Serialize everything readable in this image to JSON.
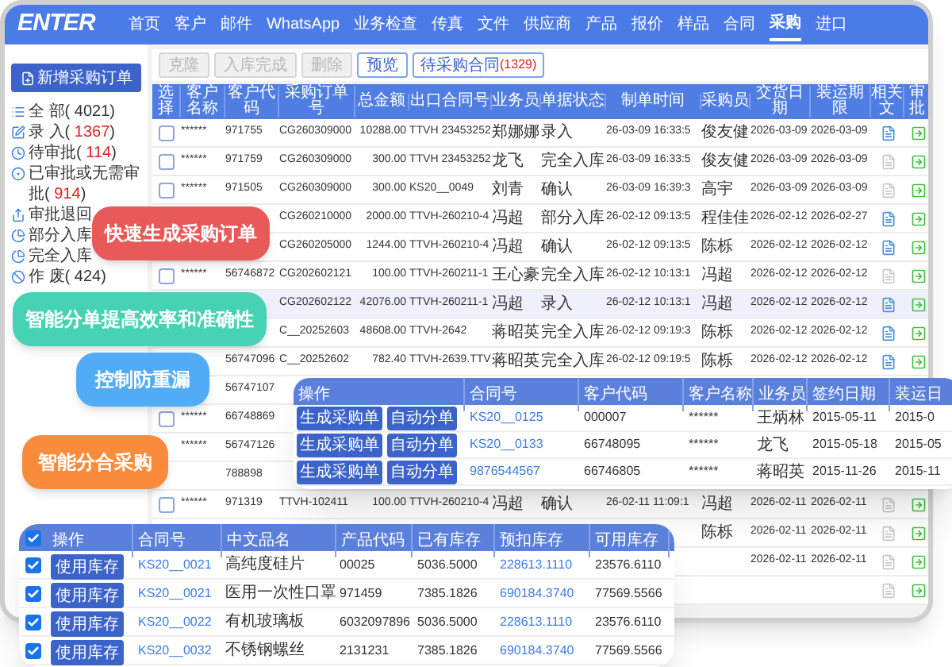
{
  "nav": {
    "logo": "ENTER",
    "items": [
      {
        "label": "首页",
        "selected": false
      },
      {
        "label": "客户",
        "selected": false
      },
      {
        "label": "邮件",
        "selected": false
      },
      {
        "label": "WhatsApp",
        "selected": false
      },
      {
        "label": "业务检查",
        "selected": false
      },
      {
        "label": "传真",
        "selected": false
      },
      {
        "label": "文件",
        "selected": false
      },
      {
        "label": "供应商",
        "selected": false
      },
      {
        "label": "产品",
        "selected": false
      },
      {
        "label": "报价",
        "selected": false
      },
      {
        "label": "样品",
        "selected": false
      },
      {
        "label": "合同",
        "selected": false
      },
      {
        "label": "采购",
        "selected": true
      },
      {
        "label": "进口",
        "selected": false
      }
    ]
  },
  "sidebar": {
    "new_button": "新增采购订单",
    "items": [
      {
        "label": "全 部(",
        "count": " 4021",
        "suffix": ")",
        "alert": false
      },
      {
        "label": "录 入(",
        "count": " 1367",
        "suffix": ")",
        "alert": true
      },
      {
        "label": "待审批(",
        "count": " 114",
        "suffix": ")",
        "alert": true
      },
      {
        "label": "已审批或无需审批(",
        "count": " 914",
        "suffix": ")",
        "alert": true
      },
      {
        "label": "审批退回"
      },
      {
        "label": "部分入库"
      },
      {
        "label": "完全入库"
      },
      {
        "label": "作 废(",
        "count": " 424",
        "suffix": ")",
        "alert": false
      }
    ]
  },
  "toolbar": {
    "buttons": [
      {
        "label": "克隆",
        "disabled": true
      },
      {
        "label": "入库完成",
        "disabled": true
      },
      {
        "label": "删除",
        "disabled": true
      },
      {
        "label": "预览",
        "disabled": false
      }
    ],
    "pending": {
      "label": "待采购合同",
      "count": "(1329)"
    }
  },
  "table": {
    "columns": [
      "选择",
      "客户名称",
      "客户代码",
      "采购订单号",
      "总金额",
      "出口合同号",
      "业务员",
      "单据状态",
      "制单时间",
      "采购员",
      "交货日期",
      "装运期限",
      "相关文",
      "审批"
    ],
    "rows": [
      {
        "selected": false,
        "checked": false,
        "name": "******",
        "code": "971755",
        "order": "CG260309000",
        "amount": "10288.00",
        "contract": "TTVH 23453252",
        "sales": "郑娜娜",
        "status": "录入",
        "created": "26-03-09 16:33:5",
        "buyer": "俊友健",
        "delivery": "2026-03-09",
        "shipment": "2026-03-09",
        "has_attachment": true,
        "approval_icon": true
      },
      {
        "selected": false,
        "checked": false,
        "name": "******",
        "code": "971759",
        "order": "CG260309000",
        "amount": "300.00",
        "contract": "TTVH 23453252",
        "sales": "龙飞",
        "status": "完全入库",
        "created": "26-03-09 16:33:5",
        "buyer": "俊友健",
        "delivery": "2026-03-09",
        "shipment": "2026-03-09",
        "has_attachment": false,
        "approval_icon": true
      },
      {
        "selected": false,
        "checked": false,
        "name": "******",
        "code": "971505",
        "order": "CG260309000",
        "amount": "300.00",
        "contract": "KS20__0049",
        "sales": "刘青",
        "status": "确认",
        "created": "26-03-09 16:39:3",
        "buyer": "高宇",
        "delivery": "2026-03-09",
        "shipment": "2026-03-09",
        "has_attachment": false,
        "approval_icon": true
      },
      {
        "selected": false,
        "order": "CG260210000",
        "amount": "2000.00",
        "contract": "TTVH-260210-4",
        "sales": "冯超",
        "status": "部分入库",
        "created": "26-02-12 09:13:5",
        "buyer": "程佳佳",
        "delivery": "2026-02-12",
        "shipment": "2026-02-27",
        "has_attachment": true,
        "approval_icon": true
      },
      {
        "selected": false,
        "order": "CG260205000",
        "amount": "1244.00",
        "contract": "TTVH-260210-4",
        "sales": "冯超",
        "status": "确认",
        "created": "26-02-12 09:13:5",
        "buyer": "陈栎",
        "delivery": "2026-02-12",
        "shipment": "2026-02-12",
        "has_attachment": true,
        "approval_icon": true
      },
      {
        "selected": false,
        "checked": false,
        "name": "******",
        "code": "56746872",
        "order": "CG202602121",
        "amount": "100.00",
        "contract": "TTVH-260211-1",
        "sales": "王心豪",
        "status": "完全入库",
        "created": "26-02-12 10:13:1",
        "buyer": "冯超",
        "delivery": "2026-02-12",
        "shipment": "2026-02-12",
        "has_attachment": false,
        "approval_icon": true
      },
      {
        "selected": true,
        "order": "CG202602122",
        "amount": "42076.00",
        "contract": "TTVH-260211-1",
        "sales": "冯超",
        "status": "录入",
        "created": "26-02-12 10:13:1",
        "buyer": "冯超",
        "delivery": "2026-02-12",
        "shipment": "2026-02-12",
        "has_attachment": true,
        "approval_icon": true
      },
      {
        "selected": false,
        "order": "C__20252603",
        "amount": "48608.00",
        "contract": "TTVH-2642",
        "sales": "蒋昭英",
        "status": "完全入库",
        "created": "26-02-12 09:19:3",
        "buyer": "陈栎",
        "delivery": "2026-02-12",
        "shipment": "2026-02-12",
        "has_attachment": true,
        "approval_icon": true
      },
      {
        "selected": false,
        "code": "56747096",
        "order": "C__20252602",
        "amount": "782.40",
        "contract": "TTVH-2639.TTV",
        "sales": "蒋昭英",
        "status": "完全入库",
        "created": "26-02-12 09:19:5",
        "buyer": "陈栎",
        "delivery": "2026-02-12",
        "shipment": "2026-02-12",
        "has_attachment": true,
        "approval_icon": true
      },
      {
        "selected": false,
        "code": "56747107"
      },
      {
        "selected": false,
        "checked": false,
        "name": "******",
        "code": "66748869"
      },
      {
        "selected": false,
        "name": "******",
        "code": "56747126"
      },
      {
        "selected": false,
        "code": "788898"
      },
      {
        "selected": false,
        "checked": false,
        "name": "******",
        "code": "971319",
        "order": "TTVH-102411",
        "amount": "100.00",
        "contract": "TTVH-260210-4",
        "sales": "冯超",
        "status": "确认",
        "created": "26-02-11 11:09:1",
        "buyer": "冯超",
        "delivery": "2026-02-11",
        "shipment": "2026-02-11",
        "has_attachment": false,
        "approval_icon": true
      },
      {
        "selected": false,
        "buyer": "陈栎",
        "delivery": "2026-02-11",
        "shipment": "2026-02-11",
        "has_attachment": false,
        "approval_icon": true
      },
      {
        "selected": false,
        "delivery": "2026-02-11",
        "shipment": "2026-02-11",
        "has_attachment": false,
        "approval_icon": true
      },
      {
        "selected": false,
        "has_attachment": false,
        "approval_icon": true
      }
    ]
  },
  "callouts": [
    {
      "text": "快速生成采购订单",
      "color": "#e85a5a"
    },
    {
      "text": "智能分单提高效率和准确性",
      "color": "#46d3b3"
    },
    {
      "text": "控制防重漏",
      "color": "#52acf5"
    },
    {
      "text": "智能分合采购",
      "color": "#f98c3c"
    }
  ],
  "contract_popup": {
    "columns": [
      "操作",
      "合同号",
      "客户代码",
      "客户名称",
      "业务员",
      "签约日期",
      "装运日"
    ],
    "rows": [
      {
        "buttons": [
          "生成采购单",
          "自动分单"
        ],
        "contract": "KS20__0125",
        "code": "000007",
        "name": "******",
        "sales": "王炳林",
        "signed": "2015-05-11",
        "shipment": "2015-0"
      },
      {
        "buttons": [
          "生成采购单",
          "自动分单"
        ],
        "contract": "KS20__0133",
        "code": "66748095",
        "name": "******",
        "sales": "龙飞",
        "signed": "2015-05-18",
        "shipment": "2015-05"
      },
      {
        "buttons": [
          "生成采购单",
          "自动分单"
        ],
        "contract": "9876544567",
        "code": "66746805",
        "name": "******",
        "sales": "蒋昭英",
        "signed": "2015-11-26",
        "shipment": "2015-11"
      }
    ]
  },
  "stock_popup": {
    "all_checked": true,
    "columns": [
      "操作",
      "合同号",
      "中文品名",
      "产品代码",
      "已有库存",
      "预扣库存",
      "可用库存"
    ],
    "rows": [
      {
        "checked": true,
        "button": "使用库存",
        "contract": "KS20__0021",
        "product": "高纯度硅片",
        "code": "00025",
        "stock": "5036.5000",
        "reserved": "228613.1110",
        "available": "23576.6110"
      },
      {
        "checked": true,
        "button": "使用库存",
        "contract": "KS20__0021",
        "product": "医用一次性口罩",
        "code": "971459",
        "stock": "7385.1826",
        "reserved": "690184.3740",
        "available": "77569.5566"
      },
      {
        "checked": true,
        "button": "使用库存",
        "contract": "KS20__0022",
        "product": "有机玻璃板",
        "code": "6032097896",
        "stock": "5036.5000",
        "reserved": "228613.1110",
        "available": "23576.6110"
      },
      {
        "checked": true,
        "button": "使用库存",
        "contract": "KS20__0032",
        "product": "不锈钢螺丝",
        "code": "2131231",
        "stock": "7385.1826",
        "reserved": "690184.3740",
        "available": "77569.5566"
      }
    ]
  }
}
